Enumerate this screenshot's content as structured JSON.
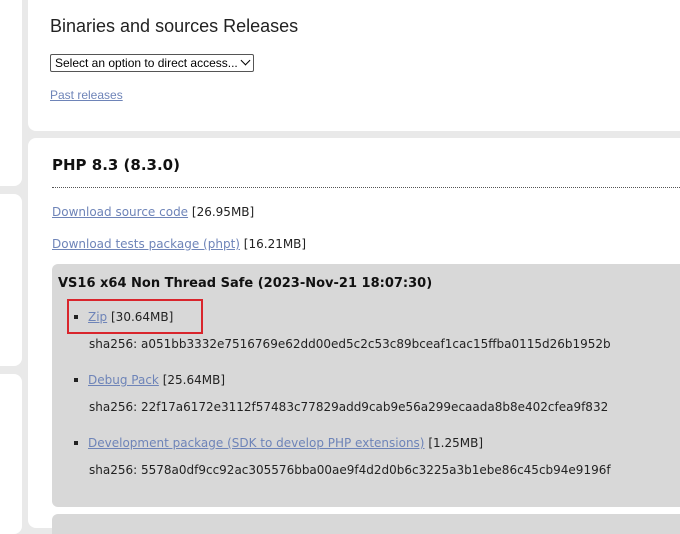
{
  "releases": {
    "title": "Binaries and sources Releases",
    "select_value": "Select an option to direct access...",
    "past_releases_label": "Past releases"
  },
  "php": {
    "title": "PHP 8.3 (8.3.0)",
    "source": {
      "label": "Download source code",
      "size": "[26.95MB]"
    },
    "tests": {
      "label": "Download tests package (phpt)",
      "size": "[16.21MB]"
    }
  },
  "build": {
    "title": "VS16 x64 Non Thread Safe (2023-Nov-21 18:07:30)",
    "items": [
      {
        "label": "Zip",
        "size": "[30.64MB]",
        "sha": "sha256: a051bb3332e7516769e62dd00ed5c2c53c89bceaf1cac15ffba0115d26b1952b"
      },
      {
        "label": "Debug Pack",
        "size": "[25.64MB]",
        "sha": "sha256: 22f17a6172e3112f57483c77829add9cab9e56a299ecaada8b8e402cfea9f832"
      },
      {
        "label": "Development package (SDK to develop PHP extensions)",
        "size": "[1.25MB]",
        "sha": "sha256: 5578a0df9cc92ac305576bba00ae9f4d2d0b6c3225a3b1ebe86c45cb94e9196f"
      }
    ]
  },
  "colors": {
    "link": "#6e84b8",
    "highlight": "#d9252c",
    "box": "#d8d8d8",
    "page_bg": "#e9e9e9"
  }
}
